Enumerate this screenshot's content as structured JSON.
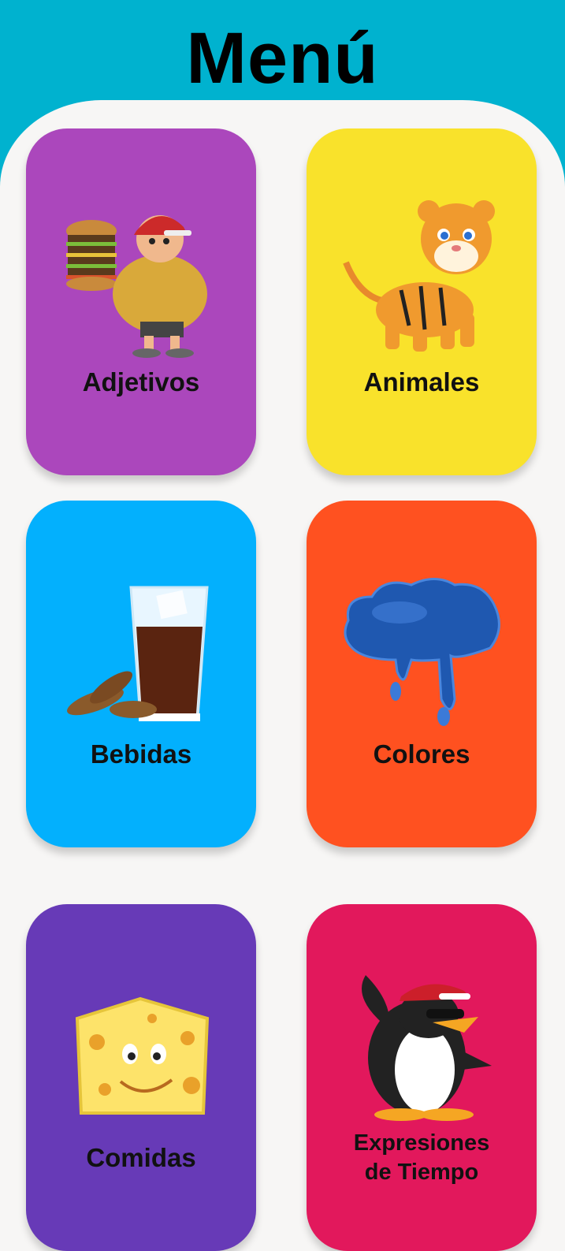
{
  "header": {
    "title": "Menú",
    "bg_color": "#00b2cf"
  },
  "menu": {
    "items": [
      {
        "label": "Adjetivos",
        "color": "#ab47bc",
        "icon": "fat-man-burger-icon"
      },
      {
        "label": "Animales",
        "color": "#f9e22b",
        "icon": "tiger-icon"
      },
      {
        "label": "Bebidas",
        "color": "#03b0fd",
        "icon": "drink-glass-icon"
      },
      {
        "label": "Colores",
        "color": "#ff5120",
        "icon": "paint-splash-icon"
      },
      {
        "label": "Comidas",
        "color": "#673ab7",
        "icon": "cheese-icon"
      },
      {
        "label": "Expresiones",
        "label2": "de Tiempo",
        "color": "#e2185c",
        "icon": "penguin-icon"
      }
    ]
  }
}
